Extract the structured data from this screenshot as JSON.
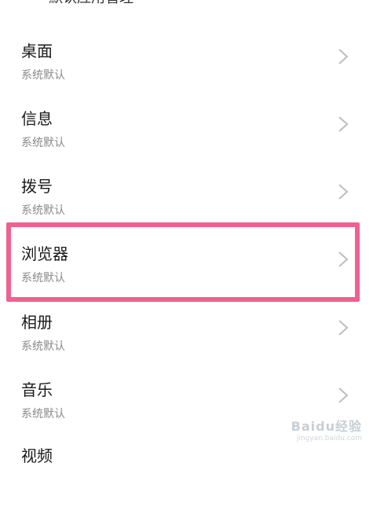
{
  "header": {
    "title": "默认应用管理"
  },
  "items": [
    {
      "title": "桌面",
      "subtitle": "系统默认"
    },
    {
      "title": "信息",
      "subtitle": "系统默认"
    },
    {
      "title": "拨号",
      "subtitle": "系统默认"
    },
    {
      "title": "浏览器",
      "subtitle": "系统默认",
      "highlighted": true
    },
    {
      "title": "相册",
      "subtitle": "系统默认"
    },
    {
      "title": "音乐",
      "subtitle": "系统默认"
    },
    {
      "title": "视频",
      "subtitle": ""
    }
  ],
  "highlight_color": "#f0618f",
  "watermark": {
    "brand": "Baidu经验",
    "url": "jingyan.baidu.com"
  }
}
